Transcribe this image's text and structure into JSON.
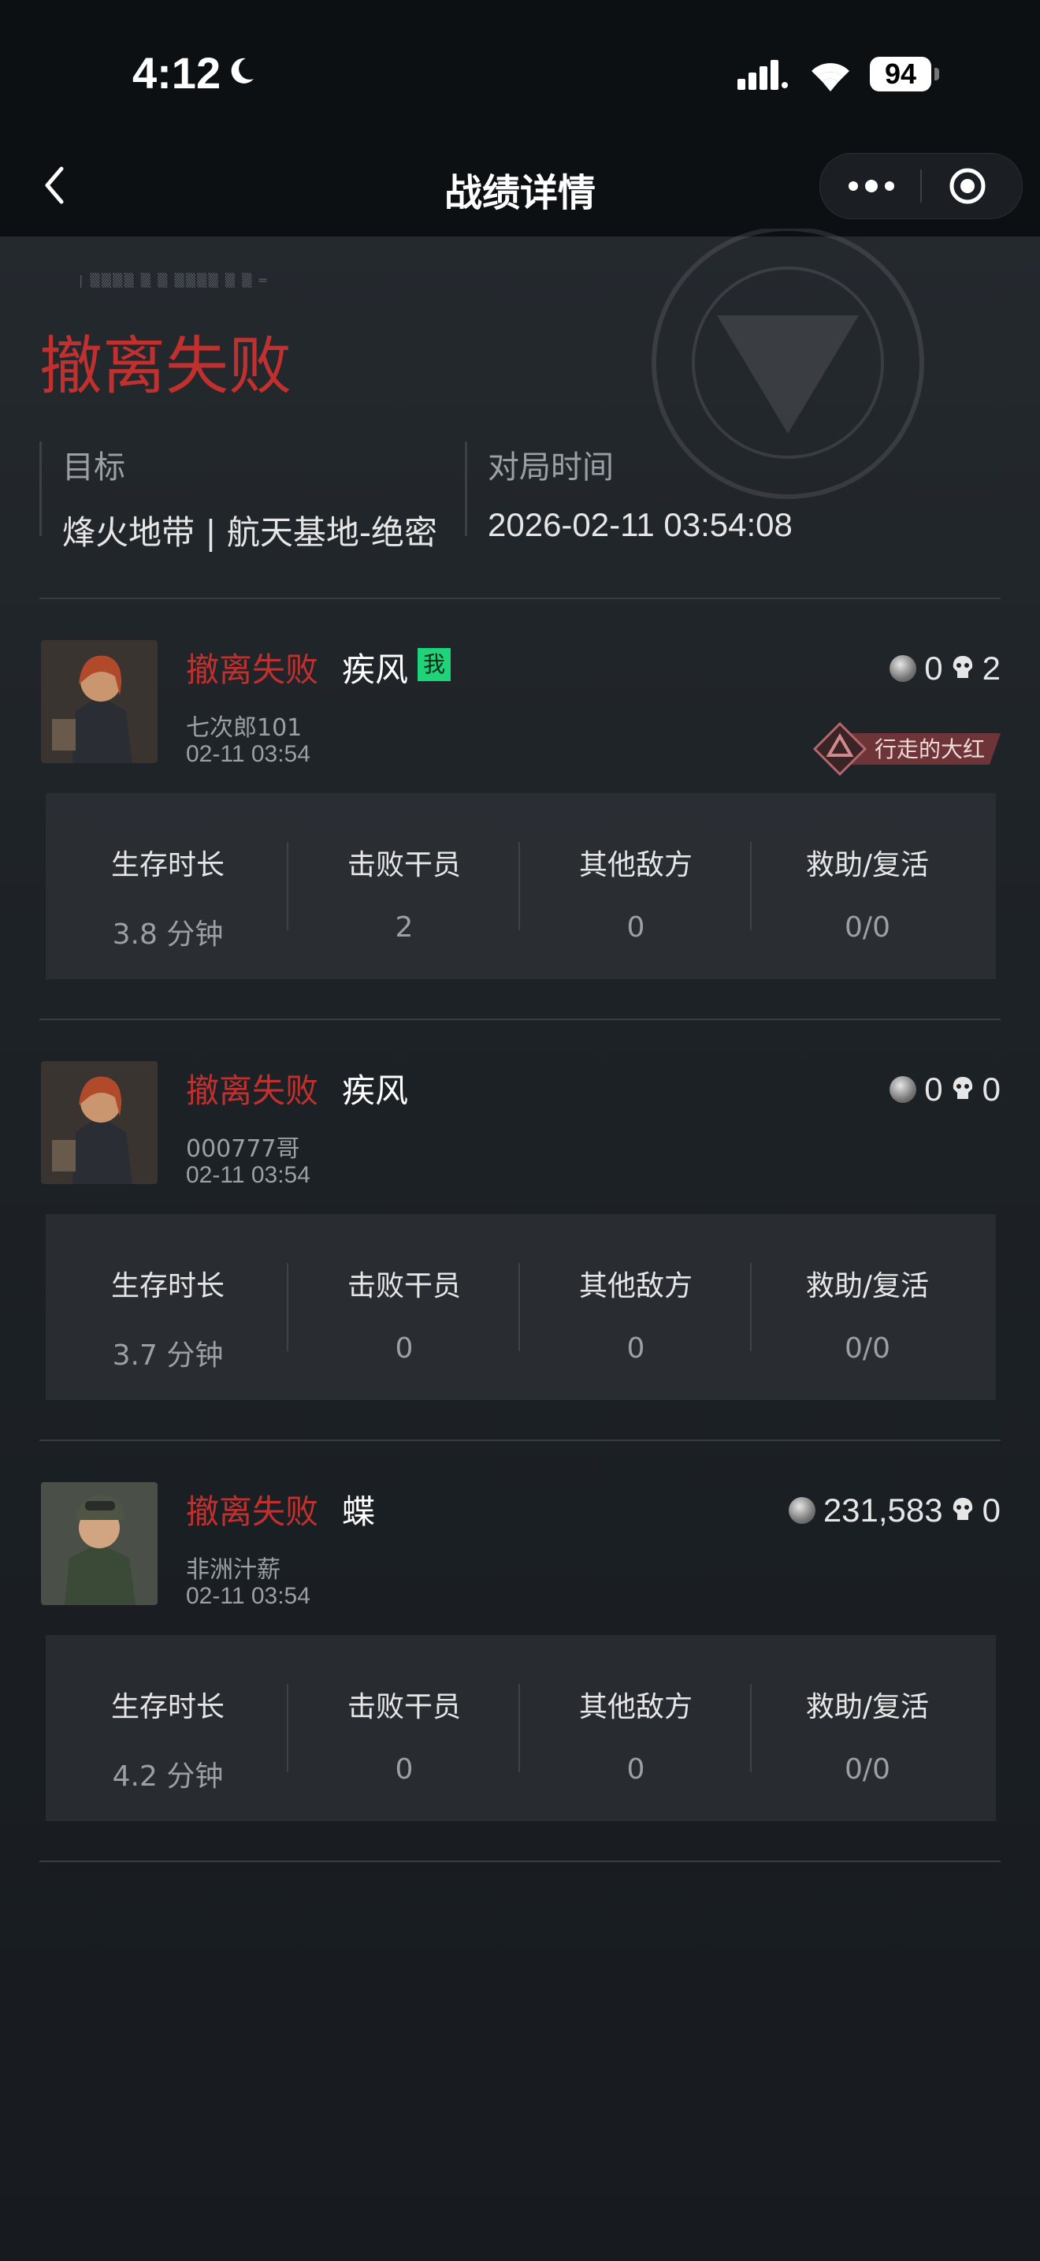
{
  "status": {
    "time": "4:12",
    "battery": "94"
  },
  "nav": {
    "title": "战绩详情"
  },
  "header": {
    "title": "撤离失败",
    "target_label": "目标",
    "target_value": "烽火地带 | 航天基地-绝密",
    "time_label": "对局时间",
    "time_value": "2026-02-11 03:54:08"
  },
  "stat_labels": {
    "survival": "生存时长",
    "kills": "击败干员",
    "others": "其他敌方",
    "assist": "救助/复活"
  },
  "players": [
    {
      "result": "撤离失败",
      "operator": "疾风",
      "me_badge": "我",
      "player": "七次郎101",
      "time": "02-11 03:54",
      "coins": "0",
      "kills_icon_count": "2",
      "title_badge": "行走的大红",
      "survival": "3.8 分钟",
      "kills": "2",
      "others": "0",
      "assist": "0/0"
    },
    {
      "result": "撤离失败",
      "operator": "疾风",
      "player": "000777哥",
      "time": "02-11 03:54",
      "coins": "0",
      "kills_icon_count": "0",
      "survival": "3.7 分钟",
      "kills": "0",
      "others": "0",
      "assist": "0/0"
    },
    {
      "result": "撤离失败",
      "operator": "蝶",
      "player": "非洲汁薪",
      "time": "02-11 03:54",
      "coins": "231,583",
      "kills_icon_count": "0",
      "survival": "4.2 分钟",
      "kills": "0",
      "others": "0",
      "assist": "0/0"
    }
  ],
  "colors": {
    "accent_red": "#c0302e",
    "me_badge": "#1ed37a",
    "background": "#1a1e22"
  }
}
